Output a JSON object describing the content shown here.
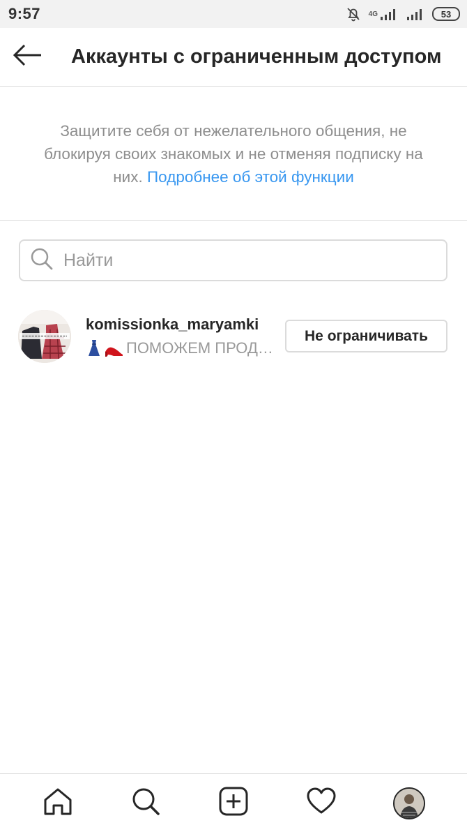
{
  "status_bar": {
    "time": "9:57",
    "network": "4G",
    "battery": "53",
    "icons": [
      "bell-muted-icon",
      "signal-icon",
      "signal-icon",
      "battery-icon"
    ]
  },
  "header": {
    "back_icon": "arrow-left-icon",
    "title": "Аккаунты с ограниченным доступом"
  },
  "description": {
    "text": "Защитите себя от нежелательного общения, не блокируя своих знакомых и не отменяя подписку на них.",
    "link": "Подробнее об этой функции"
  },
  "search": {
    "icon": "search-icon",
    "placeholder": "Найти",
    "value": ""
  },
  "accounts": [
    {
      "username": "komissionka_maryamki",
      "bio": "ПОМОЖЕМ ПРОДАТЬ",
      "bio_display": "ПОМОЖЕМ ПРОД…",
      "bio_emoji": [
        "dress-icon",
        "high-heel-icon"
      ],
      "button_label": "Не ограничивать"
    }
  ],
  "bottom_nav": {
    "items": [
      {
        "name": "home",
        "icon": "home-icon"
      },
      {
        "name": "search",
        "icon": "search-icon"
      },
      {
        "name": "add",
        "icon": "add-post-icon"
      },
      {
        "name": "activity",
        "icon": "heart-icon"
      },
      {
        "name": "profile",
        "icon": "profile-avatar"
      }
    ]
  },
  "colors": {
    "link": "#3897f0",
    "text": "#262626",
    "secondary": "#8e8e8e",
    "border": "#dbdbdb",
    "status_bar_bg": "#f2f2f2"
  }
}
